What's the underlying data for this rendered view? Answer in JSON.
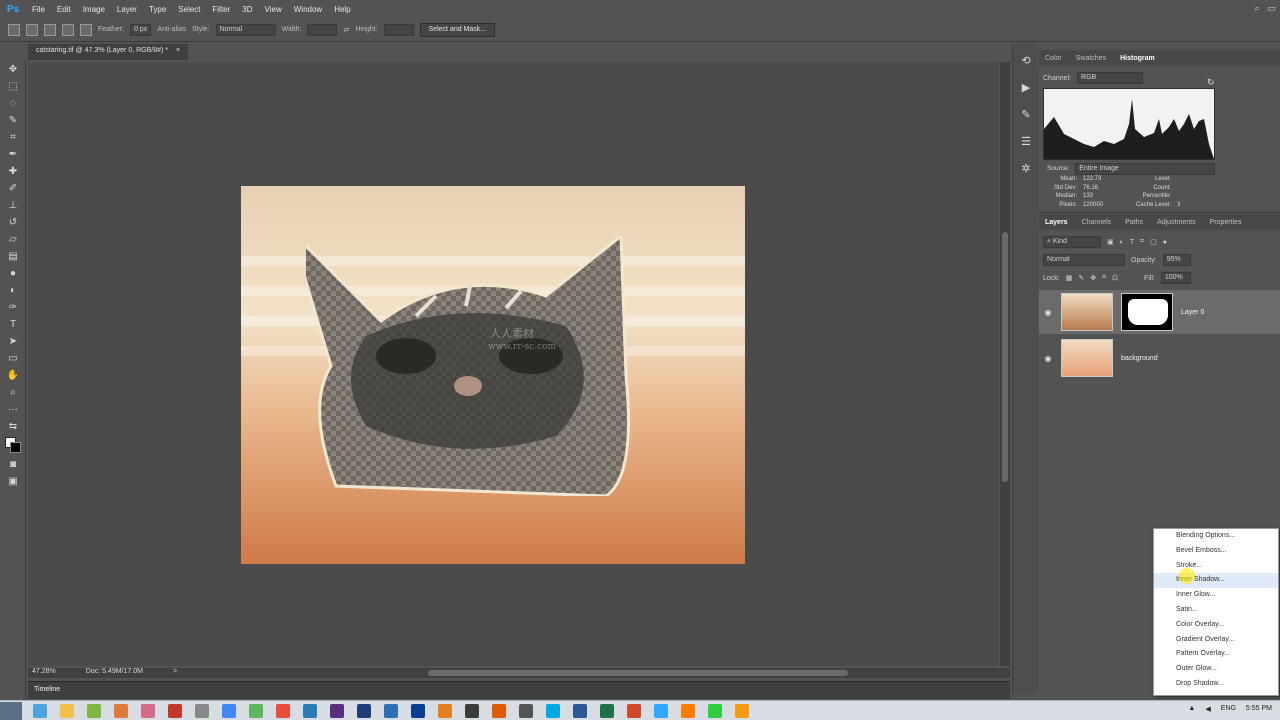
{
  "app": {
    "logo": "Ps"
  },
  "menu": [
    "File",
    "Edit",
    "Image",
    "Layer",
    "Type",
    "Select",
    "Filter",
    "3D",
    "View",
    "Window",
    "Help"
  ],
  "options": {
    "feather_label": "Feather:",
    "feather_value": "0 px",
    "antialias_label": "Anti-alias",
    "style_label": "Style:",
    "style_value": "Normal",
    "width_label": "Width:",
    "height_label": "Height:",
    "select_mask": "Select and Mask..."
  },
  "document": {
    "tab_title": "catstaring.tif @ 47.3% (Layer 0, RGB/8#) *",
    "close": "×"
  },
  "status": {
    "zoom": "47.28%",
    "doc": "Doc: 5.49M/17.0M",
    "arrow": ">"
  },
  "timeline": {
    "label": "Timeline"
  },
  "histogram": {
    "tabs": [
      "Color",
      "Swatches",
      "Histogram"
    ],
    "active_tab": "Histogram",
    "channel_label": "Channel:",
    "channel_value": "RGB",
    "source_label": "Source:",
    "source_value": "Entire Image",
    "stats_left": [
      {
        "label": "Mean:",
        "value": "122.73"
      },
      {
        "label": "Std Dev:",
        "value": "76.16"
      },
      {
        "label": "Median:",
        "value": "133"
      },
      {
        "label": "Pixels:",
        "value": "120000"
      }
    ],
    "stats_right": [
      {
        "label": "Level:",
        "value": ""
      },
      {
        "label": "Count:",
        "value": ""
      },
      {
        "label": "Percentile:",
        "value": ""
      },
      {
        "label": "Cache Level:",
        "value": "3"
      }
    ]
  },
  "layers": {
    "tabs": [
      "Layers",
      "Channels",
      "Paths",
      "Adjustments",
      "Properties"
    ],
    "active_tab": "Layers",
    "kind_label": "Kind",
    "blend_mode": "Normal",
    "opacity_label": "Opacity:",
    "opacity_value": "95%",
    "lock_label": "Lock:",
    "fill_label": "Fill:",
    "fill_value": "100%",
    "items": [
      {
        "name": "Layer 0",
        "selected": true
      },
      {
        "name": "background",
        "selected": false
      }
    ]
  },
  "context_menu": {
    "items": [
      "Blending Options...",
      "Bevel  Emboss...",
      "Stroke...",
      "Inner Shadow...",
      "Inner Glow...",
      "Satin...",
      "Color Overlay...",
      "Gradient Overlay...",
      "Pattern Overlay...",
      "Outer Glow...",
      "Drop Shadow..."
    ],
    "hovered": "Inner Shadow..."
  },
  "taskbar": {
    "language": "ENG",
    "time": "5:55 PM",
    "icon_colors": [
      "#4aa3df",
      "#f0c04a",
      "#7fb640",
      "#e07b3a",
      "#d46a8a",
      "#c0392b",
      "#888888",
      "#4285f4",
      "#5cb85c",
      "#e74c3c",
      "#2b7bb9",
      "#5a2c82",
      "#1f3d7a",
      "#2f6fb5",
      "#0b3d91",
      "#e67e22",
      "#3a3a3a",
      "#e05a00",
      "#555555",
      "#00a8e8",
      "#2b5797",
      "#1e7145",
      "#d24726",
      "#31a8ff",
      "#ff7c00",
      "#2ecc40",
      "#f39c12"
    ]
  },
  "watermark": {
    "site": "www.rr-sc.com",
    "cn": "人人素材"
  },
  "colors": {
    "ps_blue": "#31a8ff",
    "ui_bg": "#535353",
    "canvas_bg": "#4b4b4b",
    "panel_dark": "#484848"
  }
}
